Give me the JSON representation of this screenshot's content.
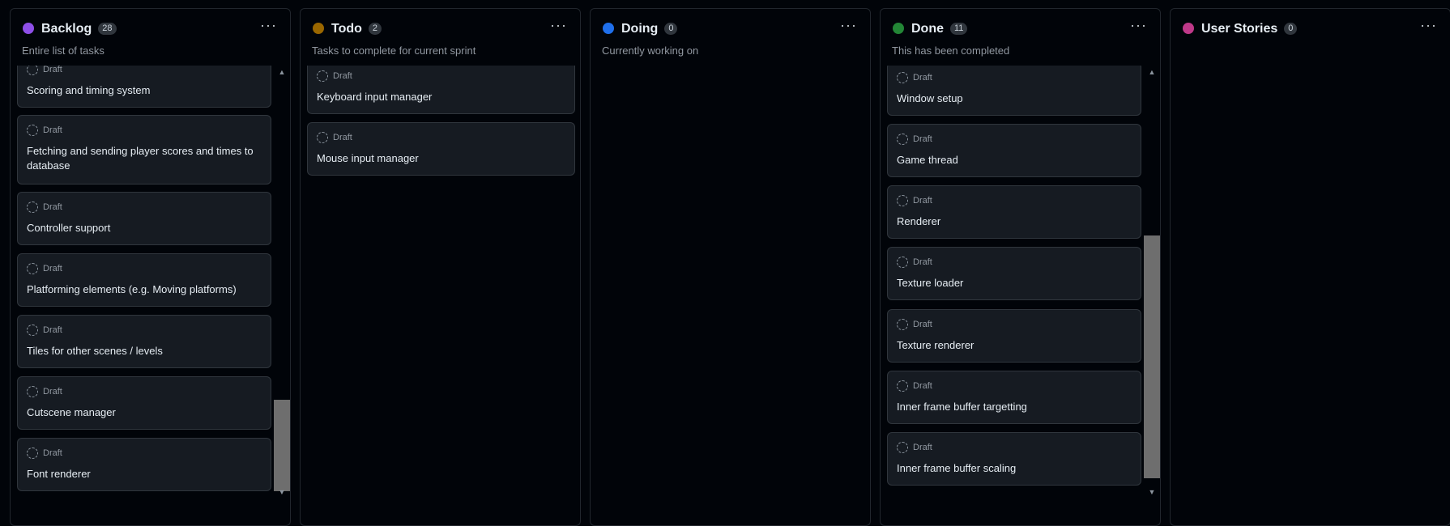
{
  "columns": [
    {
      "key": "backlog",
      "title": "Backlog",
      "count": "28",
      "description": "Entire list of tasks",
      "color": "#8e4fe8",
      "items": [
        {
          "status": "Draft",
          "title": "Scoring and timing system"
        },
        {
          "status": "Draft",
          "title": "Fetching and sending player scores and times to database"
        },
        {
          "status": "Draft",
          "title": "Controller support"
        },
        {
          "status": "Draft",
          "title": "Platforming elements (e.g. Moving platforms)"
        },
        {
          "status": "Draft",
          "title": "Tiles for other scenes / levels"
        },
        {
          "status": "Draft",
          "title": "Cutscene manager"
        },
        {
          "status": "Draft",
          "title": "Font renderer"
        }
      ],
      "scroll_position": 0.8
    },
    {
      "key": "todo",
      "title": "Todo",
      "count": "2",
      "description": "Tasks to complete for current sprint",
      "color": "#9a6700",
      "items": [
        {
          "status": "Draft",
          "title": "Keyboard input manager"
        },
        {
          "status": "Draft",
          "title": "Mouse input manager"
        }
      ]
    },
    {
      "key": "doing",
      "title": "Doing",
      "count": "0",
      "description": "Currently working on",
      "color": "#1f6feb",
      "items": []
    },
    {
      "key": "done",
      "title": "Done",
      "count": "11",
      "description": "This has been completed",
      "color": "#238636",
      "items": [
        {
          "status": "Draft",
          "title": "Window setup"
        },
        {
          "status": "Draft",
          "title": "Game thread"
        },
        {
          "status": "Draft",
          "title": "Renderer"
        },
        {
          "status": "Draft",
          "title": "Texture loader"
        },
        {
          "status": "Draft",
          "title": "Texture renderer"
        },
        {
          "status": "Draft",
          "title": "Inner frame buffer targetting"
        },
        {
          "status": "Draft",
          "title": "Inner frame buffer scaling"
        }
      ],
      "scroll_position": 0.45
    },
    {
      "key": "user-stories",
      "title": "User Stories",
      "count": "0",
      "description": "",
      "color": "#bf3989",
      "items": []
    }
  ],
  "icons": {
    "more": "more-horizontal-icon",
    "draft": "draft-circle-icon",
    "scroll_up": "chevron-up-icon",
    "scroll_down": "chevron-down-icon"
  }
}
